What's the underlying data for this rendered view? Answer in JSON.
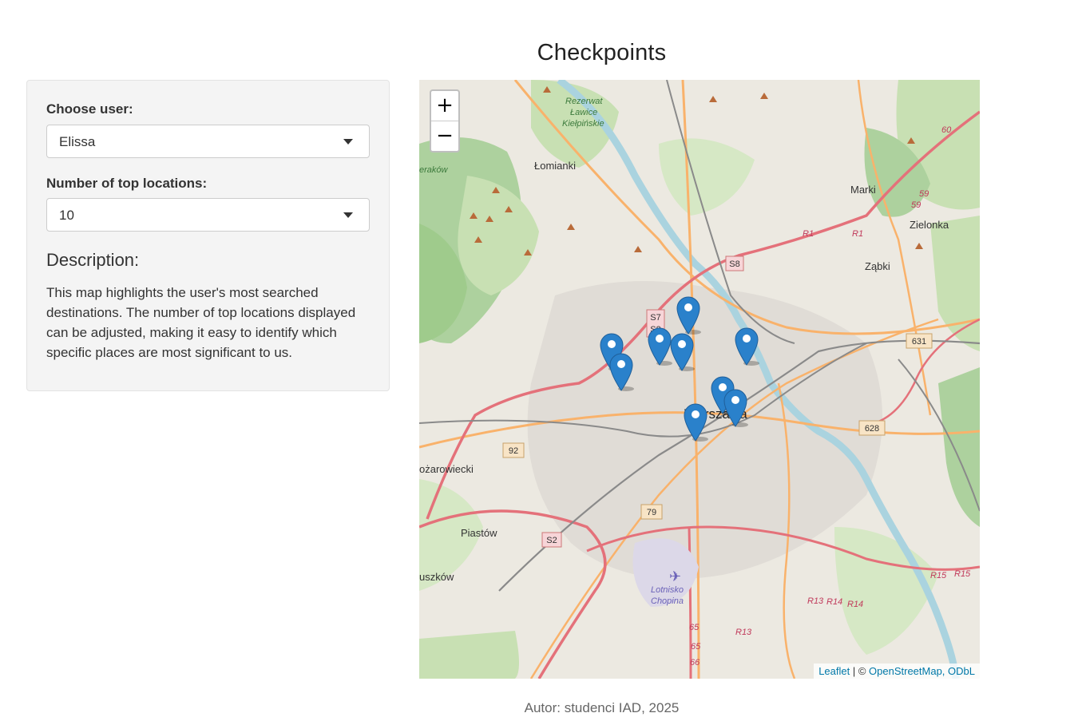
{
  "page": {
    "title": "Checkpoints",
    "footer": "Autor: studenci IAD, 2025"
  },
  "sidebar": {
    "user_label": "Choose user:",
    "user_value": "Elissa",
    "top_label": "Number of top locations:",
    "top_value": "10",
    "desc_heading": "Description:",
    "desc_text": "This map highlights the user's most searched destinations. The number of top locations displayed can be adjusted, making it easy to identify which specific places are most significant to us."
  },
  "map": {
    "zoom_in": "+",
    "zoom_out": "−",
    "attribution": {
      "leaflet": "Leaflet",
      "sep": " | © ",
      "osm": "OpenStreetMap, ODbL"
    },
    "marker_icon": "map-pin-icon",
    "marker_color": "#2a81cb",
    "place_labels": {
      "lomianki": "Łomianki",
      "marki": "Marki",
      "zielonka": "Zielonka",
      "zabki": "Ząbki",
      "warszawa": "Warszawa",
      "ozarow": "ożarowiecki",
      "piastow": "Piastów",
      "pruszkow": "uszków",
      "lotnisko1": "Lotnisko",
      "lotnisko2": "Chopina",
      "rezerwat1": "Rezerwat",
      "rezerwat2": "Ławice",
      "rezerwat3": "Kiełpińskie",
      "bemowo": "eraków"
    },
    "road_labels": {
      "s8": "S8",
      "s7": "S7",
      "s8b": "S8",
      "r1a": "R1",
      "r1b": "R1",
      "r59a": "59",
      "r59b": "59",
      "r60": "60",
      "r631": "631",
      "r628": "628",
      "r92": "92",
      "r79": "79",
      "s2": "S2",
      "r15a": "R15",
      "r15b": "R15",
      "r13": "R13",
      "r14a": "R14",
      "r14b": "R14",
      "r13b": "R13",
      "r65a": "65",
      "r65b": "65",
      "r66": "66"
    }
  }
}
